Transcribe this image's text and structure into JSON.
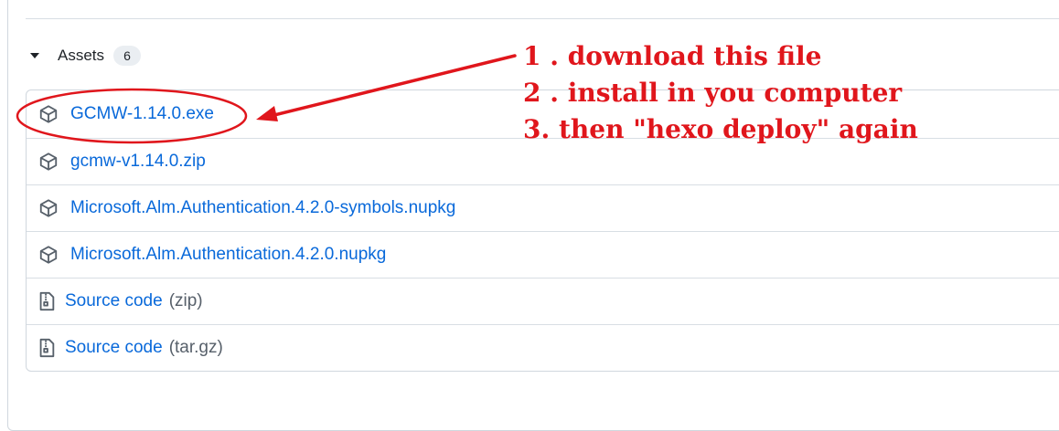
{
  "assets": {
    "title": "Assets",
    "count": "6",
    "items": [
      {
        "label": "GCMW-1.14.0.exe",
        "suffix": "",
        "icon": "package-icon"
      },
      {
        "label": "gcmw-v1.14.0.zip",
        "suffix": "",
        "icon": "package-icon"
      },
      {
        "label": "Microsoft.Alm.Authentication.4.2.0-symbols.nupkg",
        "suffix": "",
        "icon": "package-icon"
      },
      {
        "label": "Microsoft.Alm.Authentication.4.2.0.nupkg",
        "suffix": "",
        "icon": "package-icon"
      },
      {
        "label": "Source code",
        "suffix": "(zip)",
        "icon": "file-zip-icon"
      },
      {
        "label": "Source code",
        "suffix": "(tar.gz)",
        "icon": "file-zip-icon"
      }
    ]
  },
  "annotation": {
    "lines": [
      "1 . download this file",
      "2 . install in you computer",
      "3. then \"hexo deploy\" again"
    ],
    "color": "#e0161c"
  },
  "colors": {
    "link": "#0969da",
    "text": "#1f2328",
    "muted": "#57606a",
    "border": "#d0d7de"
  }
}
